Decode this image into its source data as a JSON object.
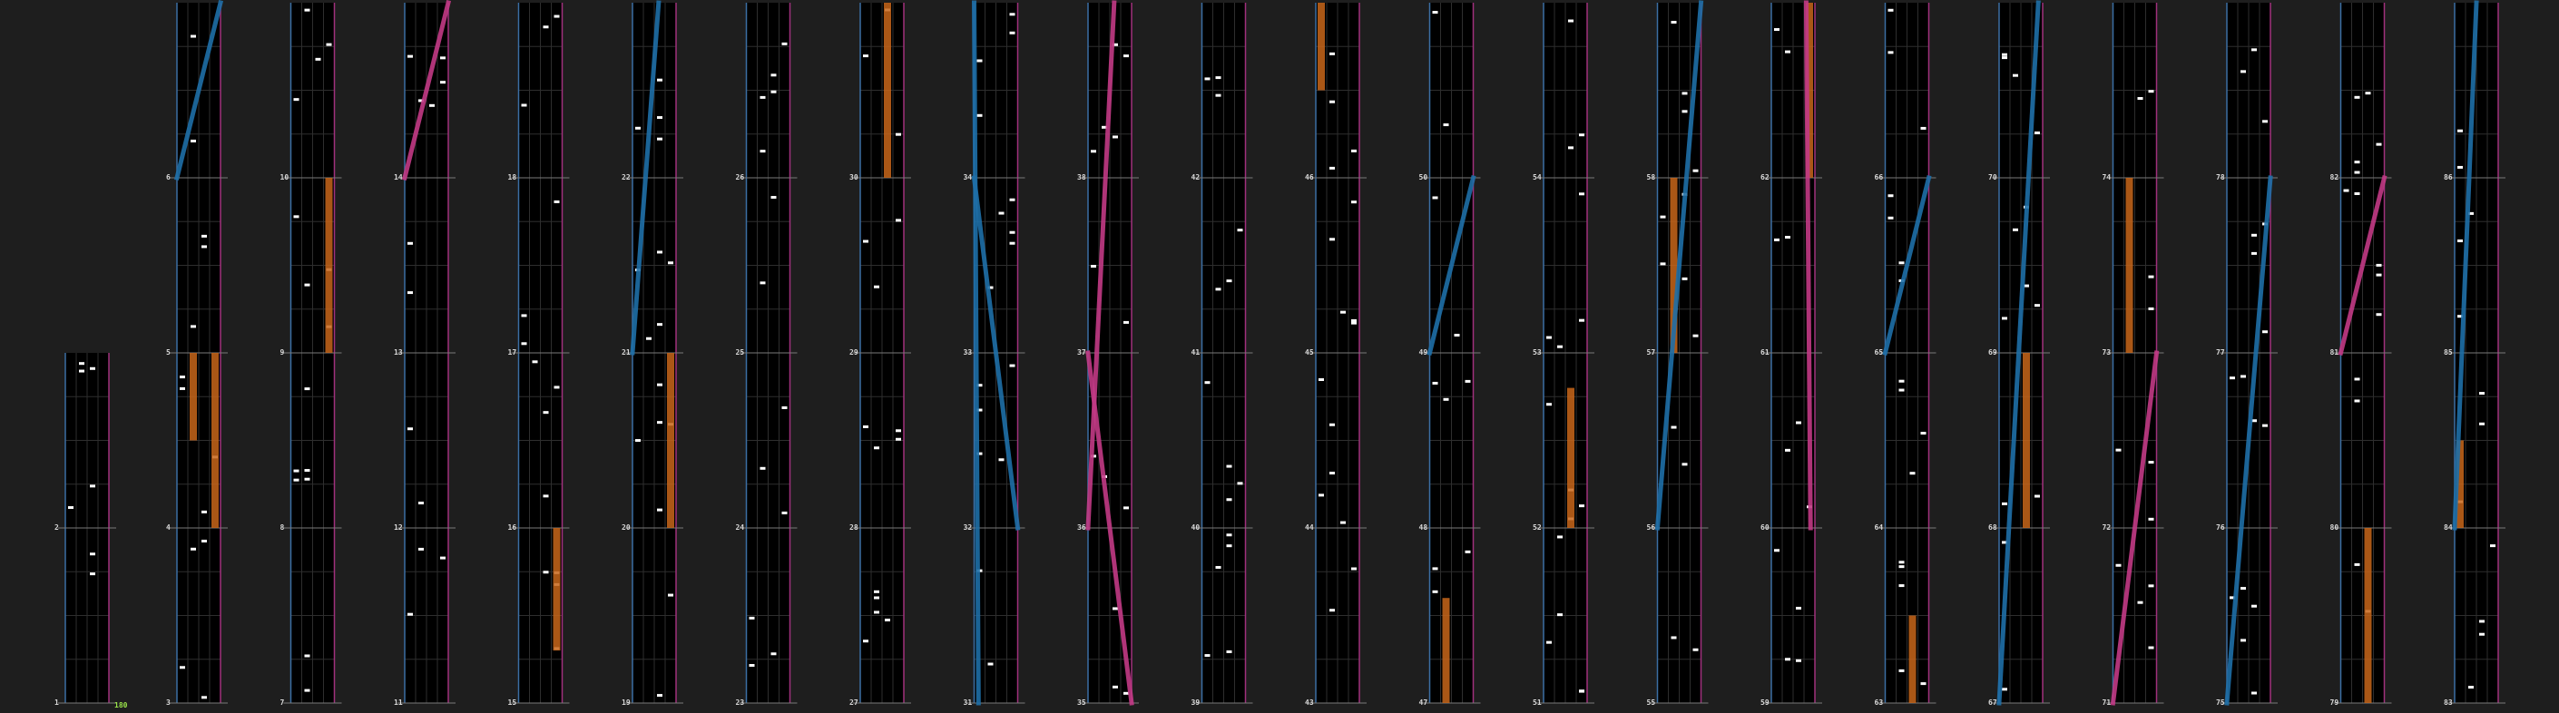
{
  "chart_data": {
    "type": "rhythm-game-chart-preview",
    "bpm_marker": "180",
    "measure_numbers_first": 1,
    "measure_numbers_last": 86,
    "measures_per_column": 4,
    "colors": {
      "background": "#1e1e1e",
      "lane_bg": "#000000",
      "beat_line": "#7a7a7a",
      "sub_line": "#2e2e2e",
      "note": "#ffffff",
      "hold": "#c8661a",
      "laser_left": "#1f6fa8",
      "laser_right": "#c23a86",
      "left_edge": "#3b6ea3",
      "right_edge": "#a0307c",
      "bpm": "#9be64a"
    },
    "icons": [
      "measure-number",
      "chip-note",
      "hold-note",
      "laser-left",
      "laser-right",
      "bpm-marker"
    ]
  }
}
